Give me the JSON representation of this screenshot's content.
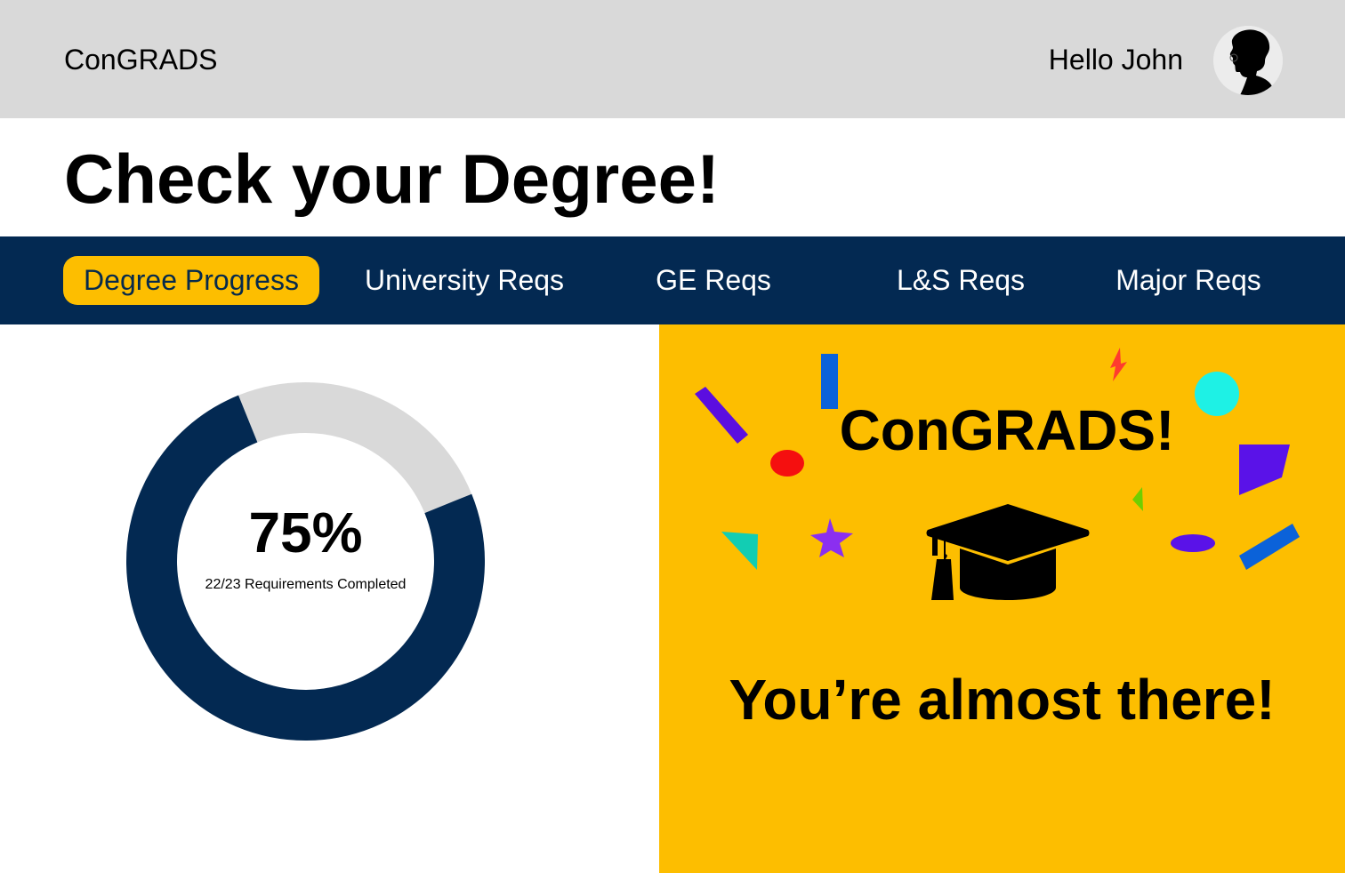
{
  "header": {
    "brand": "ConGRADS",
    "greeting": "Hello John",
    "avatar_icon": "user-avatar-silhouette-icon"
  },
  "page": {
    "title": "Check your Degree!"
  },
  "tabs": [
    {
      "label": "Degree Progress",
      "active": true
    },
    {
      "label": "University Reqs",
      "active": false
    },
    {
      "label": "GE Reqs",
      "active": false
    },
    {
      "label": "L&S Reqs",
      "active": false
    },
    {
      "label": "Major Reqs",
      "active": false
    }
  ],
  "progress": {
    "percent_label": "75%",
    "percent_value": 75,
    "requirements_text": "22/23 Requirements Completed",
    "completed_color": "#032952",
    "remaining_color": "#d9d9d9"
  },
  "celebration": {
    "heading": "ConGRADS!",
    "message": "You’re almost there!",
    "icon": "graduation-cap-icon",
    "background_color": "#fdbe00",
    "confetti_colors": [
      "#5b0ee0",
      "#0b62d9",
      "#f50f0f",
      "#ff3b2e",
      "#1ef1e5",
      "#5a12e8",
      "#12cdb3",
      "#8b2ff0",
      "#6fcf00"
    ]
  },
  "colors": {
    "topbar": "#d9d9d9",
    "navbar": "#032952",
    "active_tab": "#fdbe00",
    "accent": "#fdbe00"
  }
}
